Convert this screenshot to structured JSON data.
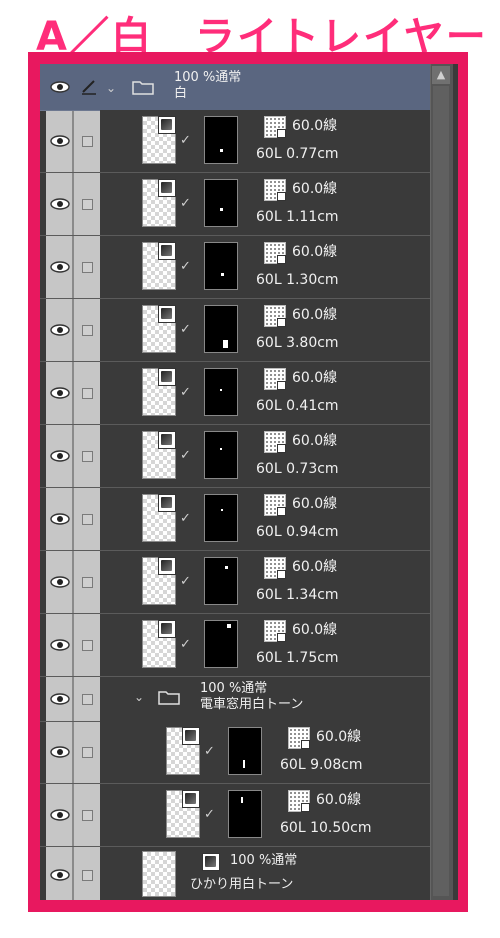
{
  "title": "A／白＿ライトレイヤー",
  "panel": {
    "folder": {
      "opacity_mode": "100 %通常",
      "name": "白"
    },
    "layers": [
      {
        "tone": "60.0線",
        "detail": "60L 0.77cm"
      },
      {
        "tone": "60.0線",
        "detail": "60L 1.11cm"
      },
      {
        "tone": "60.0線",
        "detail": "60L 1.30cm"
      },
      {
        "tone": "60.0線",
        "detail": "60L 3.80cm"
      },
      {
        "tone": "60.0線",
        "detail": "60L 0.41cm"
      },
      {
        "tone": "60.0線",
        "detail": "60L 0.73cm"
      },
      {
        "tone": "60.0線",
        "detail": "60L 0.94cm"
      },
      {
        "tone": "60.0線",
        "detail": "60L 1.34cm"
      },
      {
        "tone": "60.0線",
        "detail": "60L 1.75cm"
      }
    ],
    "subfolder": {
      "opacity_mode": "100 %通常",
      "name": "電車窓用白トーン"
    },
    "sublayers": [
      {
        "tone": "60.0線",
        "detail": "60L 9.08cm"
      },
      {
        "tone": "60.0線",
        "detail": "60L 10.50cm"
      }
    ],
    "last_layer": {
      "opacity_mode": "100 %通常",
      "name": "ひかり用白トーン"
    }
  },
  "colors": {
    "frame": "#e8185f",
    "title": "#ff2d7a",
    "panel_bg": "#3a3a3a",
    "folder_header": "#5a6680"
  },
  "icons": {
    "visibility": "eye-icon",
    "lock": "checkbox-icon",
    "folder": "folder-icon",
    "expand": "chevron-down-icon"
  }
}
